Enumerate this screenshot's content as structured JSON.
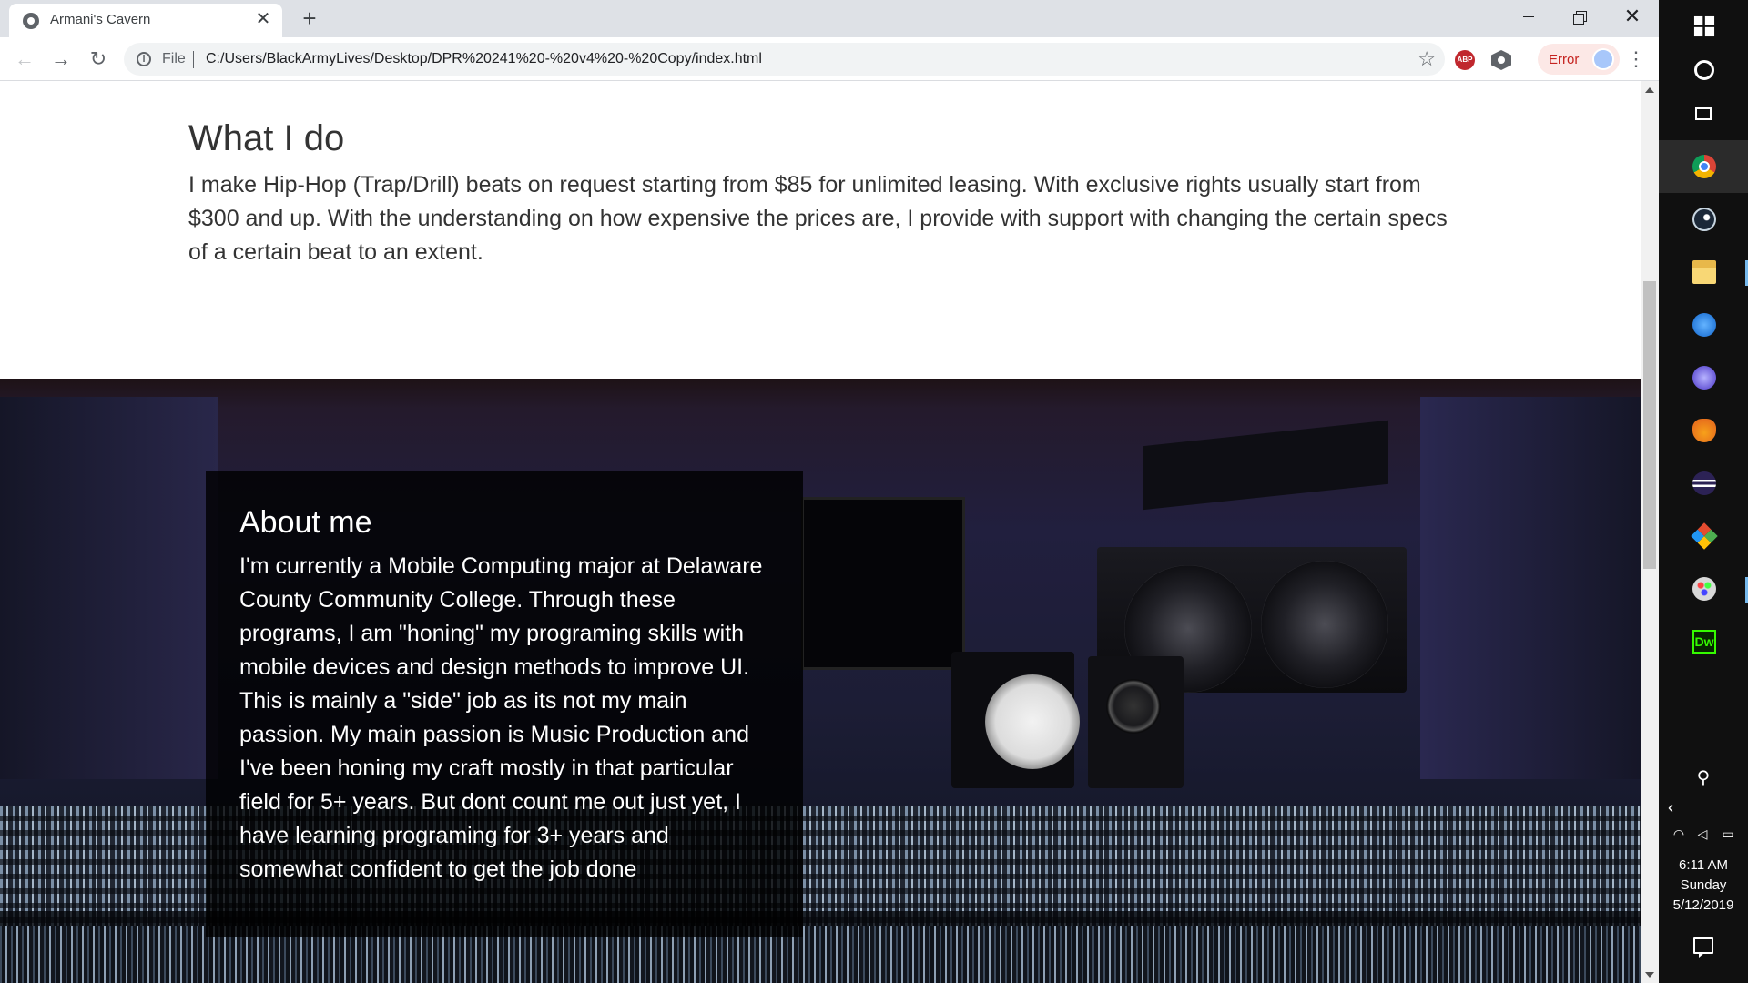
{
  "browser": {
    "tab": {
      "title": "Armani's Cavern",
      "close_glyph": "✕"
    },
    "new_tab_glyph": "+",
    "window_controls": {
      "close_glyph": "✕"
    },
    "address_bar": {
      "scheme_label": "File",
      "url": "C:/Users/BlackArmyLives/Desktop/DPR%20241%20-%20v4%20-%20Copy/index.html",
      "bookmark_icon": "star-icon"
    },
    "nav": {
      "back_glyph": "←",
      "forward_glyph": "→",
      "reload_glyph": "↻"
    },
    "extensions": {
      "abp_label": "ABP"
    },
    "profile_chip": {
      "label": "Error",
      "color": "#c5221f"
    },
    "menu_glyph": "⋮"
  },
  "page": {
    "what_i_do": {
      "heading": "What I do",
      "body": "I make Hip-Hop (Trap/Drill) beats on request starting from $85 for unlimited leasing. With exclusive rights usually start from $300 and up. With the understanding on how expensive the prices are, I provide with support with changing the certain specs of a certain beat to an extent."
    },
    "about_me": {
      "heading": "About me",
      "body": "I'm currently a Mobile Computing major at Delaware County Community College. Through these programs, I am \"honing\" my programing skills with mobile devices and design methods to improve UI. This is mainly a \"side\" job as its not my main passion. My main passion is Music Production and I've been honing my craft mostly in that particular field for 5+ years. But dont count me out just yet, I have learning programing for 3+ years and somewhat confident to get the job done"
    }
  },
  "taskbar": {
    "pinned_apps": [
      "chrome-icon",
      "steam-icon",
      "file-explorer-icon",
      "bolt-icon",
      "torrent-icon",
      "fl-studio-icon",
      "eclipse-icon",
      "git-icon",
      "paint-icon",
      "dreamweaver-icon"
    ],
    "dreamweaver_label": "Dw",
    "people_glyph": "⚲",
    "tray_chevron_glyph": "‹",
    "clock": {
      "time": "6:11 AM",
      "day": "Sunday",
      "date": "5/12/2019"
    }
  }
}
